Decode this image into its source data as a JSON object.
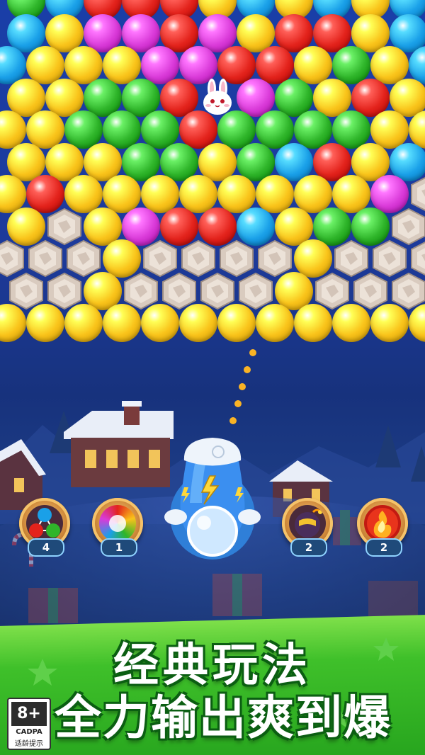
{
  "game": {
    "colors": {
      "red": "#e3231c",
      "yellow": "#f9c31a",
      "green": "#2fb52a",
      "blue": "#1aa0e8",
      "magenta": "#d93ad8",
      "rock": "#d9cbbf"
    },
    "bubble_rows": [
      [
        "green",
        "blue",
        "red",
        "red",
        "red",
        "yellow",
        "blue",
        "yellow",
        "blue",
        "yellow",
        "blue"
      ],
      [
        "blue",
        "yellow",
        "magenta",
        "magenta",
        "red",
        "magenta",
        "yellow",
        "red",
        "red",
        "yellow",
        "blue"
      ],
      [
        "blue",
        "yellow",
        "yellow",
        "yellow",
        "magenta",
        "magenta",
        "red",
        "red",
        "yellow",
        "green",
        "yellow",
        "blue"
      ],
      [
        "yellow",
        "yellow",
        "green",
        "green",
        "red",
        "bunny",
        "magenta",
        "green",
        "yellow",
        "red",
        "yellow"
      ],
      [
        "yellow",
        "yellow",
        "green",
        "green",
        "green",
        "red",
        "green",
        "green",
        "green",
        "green",
        "yellow",
        "yellow"
      ],
      [
        "yellow",
        "yellow",
        "yellow",
        "green",
        "green",
        "yellow",
        "green",
        "blue",
        "red",
        "yellow",
        "blue"
      ],
      [
        "yellow",
        "red",
        "yellow",
        "yellow",
        "yellow",
        "yellow",
        "yellow",
        "yellow",
        "yellow",
        "yellow",
        "magenta",
        "rock"
      ],
      [
        "yellow",
        "rock",
        "yellow",
        "magenta",
        "red",
        "red",
        "blue",
        "yellow",
        "green",
        "green",
        "rock"
      ],
      [
        "rock",
        "rock",
        "rock",
        "yellow",
        "rock",
        "rock",
        "rock",
        "rock",
        "yellow",
        "rock",
        "rock",
        "rock"
      ],
      [
        "rock",
        "rock",
        "yellow",
        "rock",
        "rock",
        "rock",
        "rock",
        "yellow",
        "rock",
        "rock",
        "rock"
      ],
      [
        "yellow",
        "yellow",
        "yellow",
        "yellow",
        "yellow",
        "yellow",
        "yellow",
        "yellow",
        "yellow",
        "yellow",
        "yellow",
        "yellow"
      ]
    ],
    "shooter": {
      "current_bubble": "white",
      "icon": "lightning-icon"
    },
    "boosters": [
      {
        "name": "tri-color-bubbles",
        "count": "4"
      },
      {
        "name": "rainbow-bubble",
        "count": "1"
      },
      {
        "name": "bomb-bubble",
        "count": "2"
      },
      {
        "name": "fire-bubble",
        "count": "2"
      }
    ]
  },
  "promo": {
    "line1": "经典玩法",
    "line2": "全力输出爽到爆"
  },
  "age_rating": {
    "rating": "8+",
    "org": "CADPA",
    "label": "适龄提示"
  }
}
